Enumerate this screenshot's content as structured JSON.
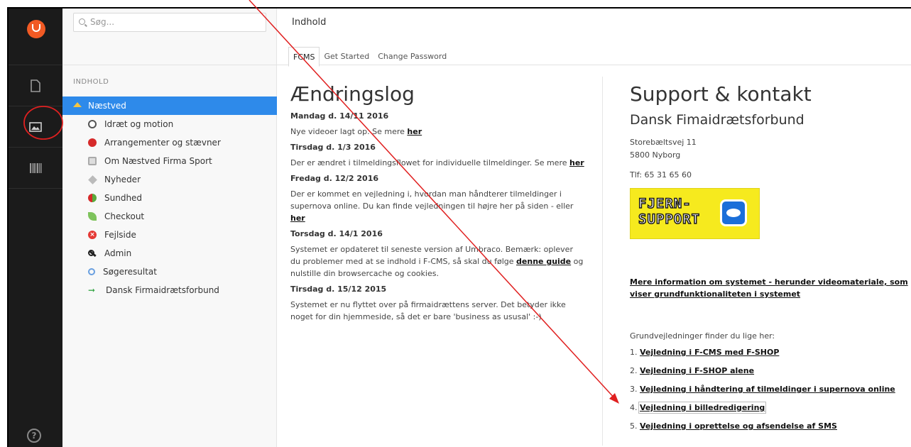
{
  "search": {
    "placeholder": "Søg..."
  },
  "rail": {
    "logo": "umbraco-logo-icon",
    "sections": [
      "content-icon",
      "media-icon",
      "barcode-icon"
    ],
    "help_glyph": "?"
  },
  "tree": {
    "label": "INDHOLD",
    "root": {
      "label": "Næstved",
      "icon": "home-icon"
    },
    "items": [
      {
        "label": "Idræt og motion",
        "icon": "ball-icon"
      },
      {
        "label": "Arrangementer og stævner",
        "icon": "ribbon-icon"
      },
      {
        "label": "Om Næstved Firma Sport",
        "icon": "box-icon"
      },
      {
        "label": "Nyheder",
        "icon": "tag-icon"
      },
      {
        "label": "Sundhed",
        "icon": "pills-icon"
      },
      {
        "label": "Checkout",
        "icon": "leaf-icon"
      },
      {
        "label": "Fejlside",
        "icon": "error-icon"
      },
      {
        "label": "Admin",
        "icon": "wrench-icon"
      },
      {
        "label": "Søgeresultat",
        "icon": "search-icon"
      },
      {
        "label": "Dansk Firmaidrætsforbund",
        "icon": "arrow-right-icon"
      }
    ]
  },
  "editor": {
    "title": "Indhold",
    "tabs": [
      "FCMS",
      "Get Started",
      "Change Password"
    ],
    "changelog": {
      "heading": "Ændringslog",
      "entries": [
        {
          "date": "Mandag d. 14/11 2016",
          "text": "Nye videoer lagt op. Se mere ",
          "link": "her",
          "after": ""
        },
        {
          "date": "Tirsdag d. 1/3 2016",
          "text": "Der er ændret i tilmeldingsflowet for individuelle tilmeldinger. Se mere ",
          "link": "her",
          "after": ""
        },
        {
          "date": "Fredag d. 12/2 2016",
          "text": "Der er kommet en vejledning i, hvordan man håndterer tilmeldinger i supernova online. Du kan finde vejledningen til højre her på siden - eller ",
          "link": "her",
          "after": ""
        },
        {
          "date": "Torsdag d. 14/1 2016",
          "text": "Systemet er opdateret til seneste version af Umbraco. Bemærk: oplever du problemer med at se indhold i F-CMS, så skal du følge ",
          "link": "denne guide",
          "after": " og nulstille din browsercache og cookies."
        },
        {
          "date": "Tirsdag d. 15/12 2015",
          "text": "Systemet er nu flyttet over på firmaidrættens server. Det betyder ikke noget for din hjemmeside, så det er bare 'business as ususal' :-)",
          "link": "",
          "after": ""
        }
      ]
    },
    "support": {
      "heading": "Support & kontakt",
      "org": "Dansk Fimaidrætsforbund",
      "address1": "Storebæltsvej 11",
      "address2": "5800 Nyborg",
      "phone": "Tlf: 65 31 65 60",
      "banner_line1": "FJERN-",
      "banner_line2": "SUPPORT",
      "more_info": "Mere information om systemet - herunder videomateriale, som viser grundfunktionaliteten i systemet",
      "guides_intro": "Grundvejledninger finder du lige her:",
      "guides": [
        {
          "num": "1.",
          "label": "Vejledning i F-CMS med F-SHOP"
        },
        {
          "num": "2.",
          "label": "Vejledning i F-SHOP alene"
        },
        {
          "num": "3.",
          "label": "Vejledning i håndtering af tilmeldinger i supernova online"
        },
        {
          "num": "4.",
          "label": "Vejledning i billedredigering"
        },
        {
          "num": "5.",
          "label": "Vejledning i oprettelse og afsendelse af SMS"
        }
      ]
    }
  },
  "colors": {
    "accent": "#2e8aea",
    "rail": "#1b1b1b",
    "logo": "#f15a24",
    "annotation": "#e02020"
  }
}
